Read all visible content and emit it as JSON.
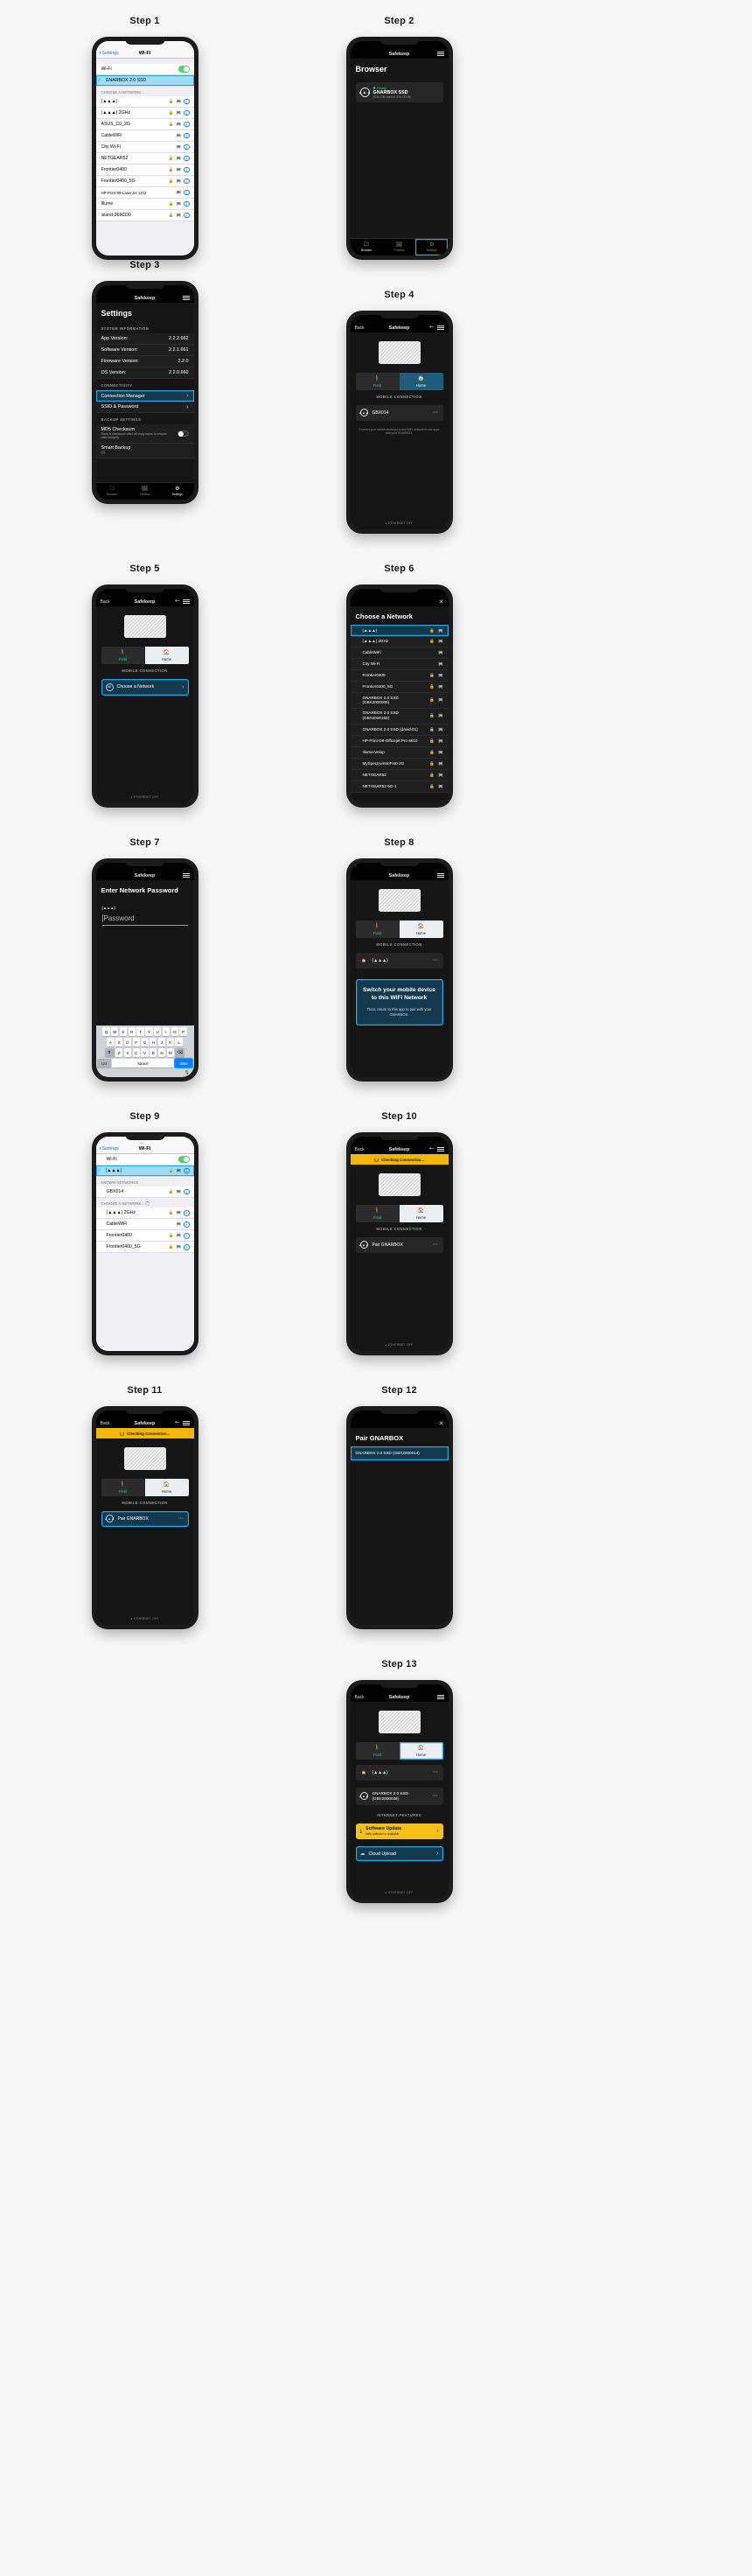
{
  "steps": [
    {
      "title": "Step 1"
    },
    {
      "title": "Step 2"
    },
    {
      "title": "Step 3"
    },
    {
      "title": "Step 4"
    },
    {
      "title": "Step 5"
    },
    {
      "title": "Step 6"
    },
    {
      "title": "Step 7"
    },
    {
      "title": "Step 8"
    },
    {
      "title": "Step 9"
    },
    {
      "title": "Step 10"
    },
    {
      "title": "Step 11"
    },
    {
      "title": "Step 12"
    },
    {
      "title": "Step 13"
    }
  ],
  "step1": {
    "nav": {
      "back": "Settings",
      "title": "Wi-Fi"
    },
    "wifi_label": "Wi-Fi",
    "connected": "GNARBOX 2.0 SSD",
    "section": "CHOOSE A NETWORK...",
    "networks": [
      "(▲▲▲)",
      "(▲▲▲) 2GHz",
      "ASUS_C0_2G",
      "CableWiFi",
      "City Wi-Fi",
      "NETGEAR52",
      "Frontier0400",
      "Frontier0400_5G",
      "HP-Print-99-LaserJet 1102",
      "Illume",
      "island-369CD0"
    ]
  },
  "step2": {
    "nav_title": "Safekeep",
    "heading": "Browser",
    "device": {
      "status": "Ready",
      "name": "GNARBOX SSD",
      "meta": "(5.54 GB used of 479.73 GB)"
    },
    "tabs": [
      "Browser",
      "Preview",
      "Settings"
    ]
  },
  "step3": {
    "nav_title": "Safekeep",
    "heading": "Settings",
    "system_information_label": "SYSTEM INFORMATION",
    "rows": [
      {
        "label": "App Version:",
        "value": "2.2.2.662"
      },
      {
        "label": "Software Version:",
        "value": "2.2.1.661"
      },
      {
        "label": "Firmware Version:",
        "value": "2.2.0"
      },
      {
        "label": "OS Version:",
        "value": "2.2.0.660"
      }
    ],
    "connectivity_label": "CONNECTIVITY",
    "connection_manager": "Connection Manager",
    "ssid_password": "SSID & Password",
    "backup_settings_label": "BACKUP SETTINGS",
    "md5": {
      "title": "MD5 Checksum",
      "sub": "Runs a checksum after all copy tasks to ensure data integrity"
    },
    "smart_backup": {
      "title": "Smart Backup",
      "sub": "(3)"
    },
    "tabs": [
      "Browser",
      "Preview",
      "Settings"
    ]
  },
  "step4": {
    "nav": {
      "back": "Back",
      "title": "Safekeep"
    },
    "field": "Field",
    "home": "Home",
    "mobile_connection_label": "MOBILE CONNECTION",
    "connection": "GBX014",
    "note": "Connect your mobile device(s) to this WiFi network to use apps with your GNARBOX.",
    "ethernet": "ETHERNET OFF"
  },
  "step5": {
    "nav": {
      "back": "Back",
      "title": "Safekeep"
    },
    "field": "Field",
    "home": "Home",
    "mobile_connection_label": "MOBILE CONNECTION",
    "choose_network": "Choose a Network",
    "ethernet": "ETHERNET OFF"
  },
  "step6": {
    "heading": "Choose a Network",
    "networks": [
      {
        "name": "(▲▲▲)",
        "lock": true,
        "selected": true
      },
      {
        "name": "(▲▲▲) 2GHz",
        "lock": true
      },
      {
        "name": "CableWiFi",
        "lock": false
      },
      {
        "name": "City Wi-Fi",
        "lock": false
      },
      {
        "name": "Frontier0400",
        "lock": true
      },
      {
        "name": "Frontier0400_5G",
        "lock": true
      },
      {
        "name": "GNARBOX 2.0 SSD (GBX2000009)",
        "lock": true
      },
      {
        "name": "GNARBOX 2.0 SSD (GBX2000152)",
        "lock": true
      },
      {
        "name": "GNARBOX 2.0 SSD (david-01)",
        "lock": true
      },
      {
        "name": "HP-Print-D8-Officejet Pro 8610",
        "lock": true
      },
      {
        "name": "Illume-Velop",
        "lock": true
      },
      {
        "name": "MySpectrumWiFi40-2G",
        "lock": true
      },
      {
        "name": "NETGEAR52",
        "lock": true
      },
      {
        "name": "NETGEAR52-5G-1",
        "lock": true
      }
    ]
  },
  "step7": {
    "nav_title": "Safekeep",
    "heading": "Enter Network Password",
    "ssid": "(▲▲▲)",
    "password_placeholder": "Password",
    "keyboard": {
      "row1": [
        "Q",
        "W",
        "E",
        "R",
        "T",
        "Y",
        "U",
        "I",
        "O",
        "P"
      ],
      "row2": [
        "A",
        "S",
        "D",
        "F",
        "G",
        "H",
        "J",
        "K",
        "L"
      ],
      "row3": [
        "Z",
        "X",
        "C",
        "V",
        "B",
        "N",
        "M"
      ],
      "shift": "⬆",
      "backspace": "⌫",
      "numbers": "123",
      "space": "space",
      "done": "done",
      "mic": "🎤"
    }
  },
  "step8": {
    "nav_title": "Safekeep",
    "field": "Field",
    "home": "Home",
    "mobile_connection_label": "MOBILE CONNECTION",
    "connection": "(▲▲▲)",
    "banner_big": "Switch your mobile device to this WiFi Network",
    "banner_small": "Then, return to this app to pair with your GNARBOX."
  },
  "step9": {
    "nav": {
      "back": "Settings",
      "title": "Wi-Fi"
    },
    "wifi_label": "Wi-Fi",
    "connected": "(▲▲▲)",
    "known_networks_label": "KNOWN NETWORKS",
    "known": [
      "GBX014"
    ],
    "choose_label": "CHOOSE A NETWORK...",
    "networks": [
      "(▲▲▲) 2GHz",
      "CableWiFi",
      "Frontier0400",
      "Frontier0400_5G"
    ]
  },
  "step10": {
    "nav": {
      "back": "Back",
      "title": "Safekeep"
    },
    "status": "Checking Connection...",
    "field": "Field",
    "home": "Home",
    "mobile_connection_label": "MOBILE CONNECTION",
    "pair": "Pair GNARBOX",
    "ethernet": "ETHERNET OFF"
  },
  "step11": {
    "nav": {
      "back": "Back",
      "title": "Safekeep"
    },
    "status": "Checking Connection...",
    "field": "Field",
    "home": "Home",
    "mobile_connection_label": "MOBILE CONNECTION",
    "pair": "Pair GNARBOX",
    "ethernet": "ETHERNET OFF"
  },
  "step12": {
    "heading": "Pair GNARBOX",
    "option": "GNARBOX 2.0 SSD (GBX2000014)"
  },
  "step13": {
    "nav": {
      "back": "Back",
      "title": "Safekeep"
    },
    "field": "Field",
    "home": "Home",
    "connection": "(▲▲▲)",
    "device": "GNARBOX 2.0 SSD (GBX2000038)",
    "internet_features_label": "INTERNET FEATURES",
    "software_update": {
      "title": "Software Update",
      "sub": "New software is available"
    },
    "cloud_upload": "Cloud Upload",
    "ethernet": "ETHERNET OFF"
  },
  "colors": {
    "accent": "#22a7e0",
    "ios_blue": "#0a7cff",
    "green": "#2ecc71",
    "yellow": "#f5c116"
  }
}
